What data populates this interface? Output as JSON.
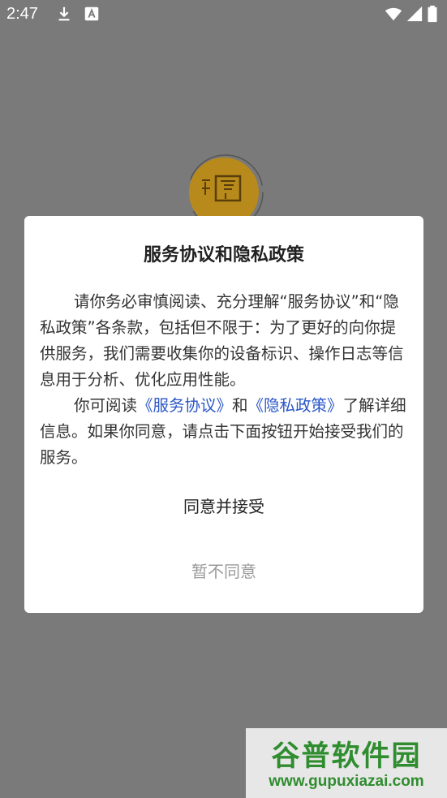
{
  "status_bar": {
    "time": "2:47",
    "icons": [
      "download-icon",
      "keyboard-a-icon",
      "wifi-icon",
      "signal-icon",
      "battery-icon"
    ]
  },
  "splash": {
    "logo_icon": "app-logo-icon"
  },
  "dialog": {
    "title": "服务协议和隐私政策",
    "para1": "请你务必审慎阅读、充分理解“服务协议”和“隐私政策”各条款，包括但不限于：为了更好的向你提供服务，我们需要收集你的设备标识、操作日志等信息用于分析、优化应用性能。",
    "para2_prefix": "你可阅读",
    "link_service": "《服务协议》",
    "para2_and": "和",
    "link_privacy": "《隐私政策》",
    "para2_suffix": "了解详细信息。如果你同意，请点击下面按钮开始接受我们的服务。",
    "agree_label": "同意并接受",
    "disagree_label": "暂不同意",
    "link_color": "#2a56c6"
  },
  "watermark": {
    "main": "谷普软件园",
    "url": "www.gupuxiazai.com"
  }
}
